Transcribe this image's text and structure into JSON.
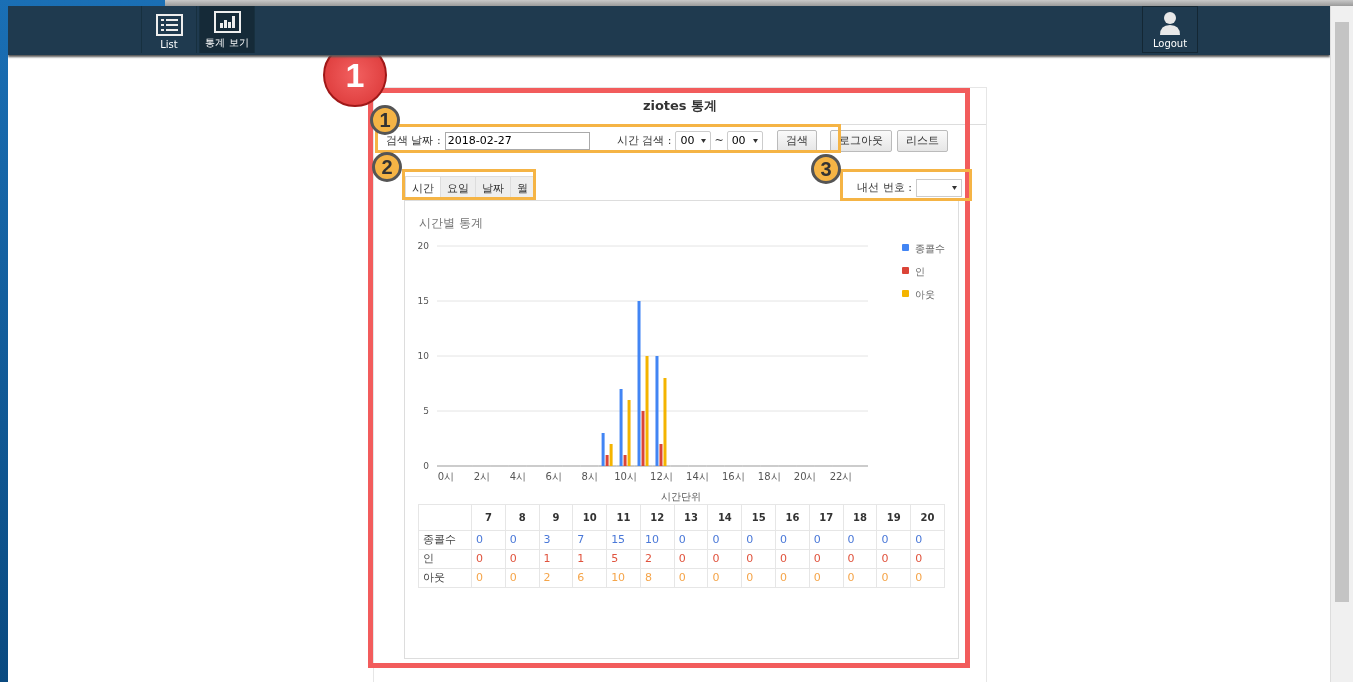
{
  "nav": {
    "items": [
      {
        "label": "List",
        "selected": false
      },
      {
        "label": "통계 보기",
        "selected": true
      }
    ],
    "logout": "Logout"
  },
  "page": {
    "title": "ziotes 통계",
    "search": {
      "date_label": "검색 날짜 :",
      "date_value": "2018-02-27",
      "time_label": "시간 검색 :",
      "from": "00",
      "separator": "~",
      "to": "00"
    },
    "buttons": [
      "검색",
      "로그아웃",
      "리스트"
    ],
    "tabs": [
      {
        "label": "시간",
        "selected": true
      },
      {
        "label": "요일",
        "selected": false
      },
      {
        "label": "날짜",
        "selected": false
      },
      {
        "label": "월",
        "selected": false
      }
    ],
    "extension_label": "내선 번호 :"
  },
  "stats": {
    "title": "시간별 통계",
    "chart_data": {
      "type": "bar",
      "xlabel": "시간단위",
      "x": [
        0,
        1,
        2,
        3,
        4,
        5,
        6,
        7,
        8,
        9,
        10,
        11,
        12,
        13,
        14,
        15,
        16,
        17,
        18,
        19,
        20,
        21,
        22,
        23
      ],
      "grid": true,
      "legend": "right",
      "xlim": [
        -0.5,
        23.5
      ],
      "xticks": [
        {
          "value": 0,
          "label": "0시"
        },
        {
          "value": 2,
          "label": "2시"
        },
        {
          "value": 4,
          "label": "4시"
        },
        {
          "value": 6,
          "label": "6시"
        },
        {
          "value": 8,
          "label": "8시"
        },
        {
          "value": 10,
          "label": "10시"
        },
        {
          "value": 12,
          "label": "12시"
        },
        {
          "value": 14,
          "label": "14시"
        },
        {
          "value": 16,
          "label": "16시"
        },
        {
          "value": 18,
          "label": "18시"
        },
        {
          "value": 20,
          "label": "20시"
        },
        {
          "value": 22,
          "label": "22시"
        }
      ],
      "ylim": [
        0,
        20
      ],
      "yticks": [
        0,
        5,
        10,
        15,
        20
      ],
      "series": [
        {
          "name": "종콜수",
          "color": "#4285f4",
          "values": [
            0,
            0,
            0,
            0,
            0,
            0,
            0,
            0,
            0,
            3,
            7,
            15,
            10,
            0,
            0,
            0,
            0,
            0,
            0,
            0,
            0,
            0,
            0,
            0
          ]
        },
        {
          "name": "인",
          "color": "#db4437",
          "values": [
            0,
            0,
            0,
            0,
            0,
            0,
            0,
            0,
            0,
            1,
            1,
            5,
            2,
            0,
            0,
            0,
            0,
            0,
            0,
            0,
            0,
            0,
            0,
            0
          ]
        },
        {
          "name": "아웃",
          "color": "#f4b400",
          "values": [
            0,
            0,
            0,
            0,
            0,
            0,
            0,
            0,
            0,
            2,
            6,
            10,
            8,
            0,
            0,
            0,
            0,
            0,
            0,
            0,
            0,
            0,
            0,
            0
          ]
        }
      ]
    },
    "table": {
      "columns": [
        "7",
        "8",
        "9",
        "10",
        "11",
        "12",
        "13",
        "14",
        "15",
        "16",
        "17",
        "18",
        "19",
        "20"
      ],
      "rows": [
        {
          "label": "종콜수",
          "color": "#4a78d8",
          "values": [
            "0",
            "0",
            "3",
            "7",
            "15",
            "10",
            "0",
            "0",
            "0",
            "0",
            "0",
            "0",
            "0",
            "0"
          ]
        },
        {
          "label": "인",
          "color": "#e0533d",
          "values": [
            "0",
            "0",
            "1",
            "1",
            "5",
            "2",
            "0",
            "0",
            "0",
            "0",
            "0",
            "0",
            "0",
            "0"
          ]
        },
        {
          "label": "아웃",
          "color": "#f5a54a",
          "values": [
            "0",
            "0",
            "2",
            "6",
            "10",
            "8",
            "0",
            "0",
            "0",
            "0",
            "0",
            "0",
            "0",
            "0"
          ]
        }
      ]
    }
  },
  "annotations": [
    {
      "number": "1",
      "kind": "frame"
    },
    {
      "number": "1",
      "kind": "box"
    },
    {
      "number": "2",
      "kind": "box"
    },
    {
      "number": "3",
      "kind": "box"
    }
  ]
}
